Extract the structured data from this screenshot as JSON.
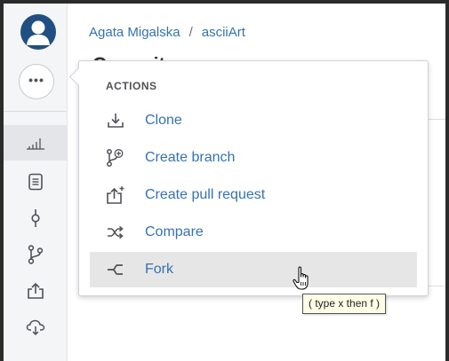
{
  "breadcrumb": {
    "user": "Agata Migalska",
    "separator": "/",
    "repo": "asciiArt"
  },
  "page_title": "Commits",
  "sidebar": {
    "more_label": "•••",
    "items": [
      {
        "name": "sidebar-item-overview",
        "icon": "bar-chart-icon",
        "active": true
      },
      {
        "name": "sidebar-item-source",
        "icon": "document-icon",
        "active": false
      },
      {
        "name": "sidebar-item-commits",
        "icon": "commit-icon",
        "active": false
      },
      {
        "name": "sidebar-item-branches",
        "icon": "branch-icon",
        "active": false
      },
      {
        "name": "sidebar-item-pull-requests",
        "icon": "pull-request-icon",
        "active": false
      },
      {
        "name": "sidebar-item-pipelines",
        "icon": "cloud-icon",
        "active": false
      }
    ]
  },
  "actions_menu": {
    "heading": "ACTIONS",
    "items": [
      {
        "label": "Clone",
        "icon": "download-icon"
      },
      {
        "label": "Create branch",
        "icon": "create-branch-icon"
      },
      {
        "label": "Create pull request",
        "icon": "create-pull-request-icon"
      },
      {
        "label": "Compare",
        "icon": "compare-icon"
      },
      {
        "label": "Fork",
        "icon": "fork-icon",
        "hovered": true
      }
    ]
  },
  "tooltip": {
    "text": "( type x then f )"
  },
  "colors": {
    "link": "#3572b0",
    "avatar": "#205081",
    "sidebar_bg": "#f4f5f7"
  }
}
